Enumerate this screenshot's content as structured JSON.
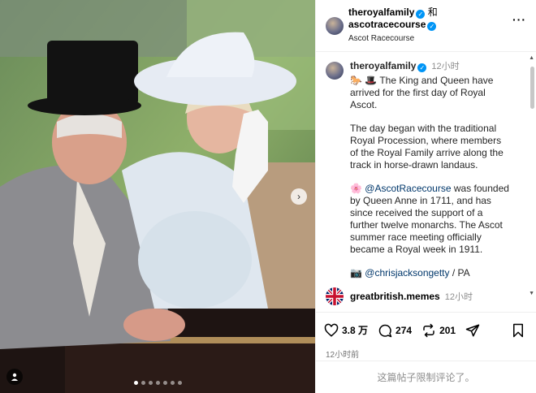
{
  "header": {
    "account1": "theroyalfamily",
    "joiner": "和",
    "account2": "ascotracecourse",
    "location": "Ascot Racecourse"
  },
  "caption": {
    "username": "theroyalfamily",
    "time": "12小时",
    "emojis": "🐎 🎩",
    "para1": "The King and Queen have arrived for the first day of Royal Ascot.",
    "para2": "The day began with the traditional Royal Procession, where members of the Royal Family arrive along the track in horse-drawn landaus.",
    "para3_emoji": "🌸",
    "para3_mention": "@AscotRacecourse",
    "para3_rest": " was founded by Queen Anne in 1711, and has since received the support of a further twelve monarchs. The Ascot summer race meeting officially became a Royal week in 1911.",
    "credit_emoji": "📷",
    "credit_mention": "@chrisjacksongetty",
    "credit_rest": " / PA"
  },
  "reply": {
    "username": "greatbritish.memes",
    "time": "12小时"
  },
  "actions": {
    "likes": "3.8 万",
    "comments": "274",
    "reposts": "201"
  },
  "timestamp": "12小时前",
  "restricted_text": "这篇帖子限制评论了。",
  "carousel": {
    "slide_count": 7,
    "active_index": 0
  },
  "colors": {
    "verified": "#0095f6",
    "link": "#00376b"
  }
}
